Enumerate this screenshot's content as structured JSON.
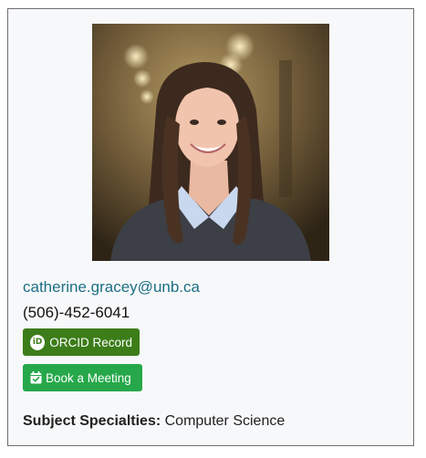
{
  "profile": {
    "photo_alt": "Catherine Gracey portrait",
    "email": "catherine.gracey@unb.ca",
    "phone": "(506)-452-6041"
  },
  "buttons": {
    "orcid_label": "ORCID Record",
    "orcid_icon": "orcid-id-icon",
    "book_label": "Book a Meeting",
    "book_icon": "calendar-check-icon"
  },
  "specialties": {
    "label": "Subject Specialties:",
    "value": "Computer Science"
  },
  "colors": {
    "email_link": "#1d6f83",
    "orcid_button": "#3c7d1a",
    "book_button": "#26a84a",
    "card_background": "#f7f8fa",
    "card_border": "#6f6f6f"
  }
}
